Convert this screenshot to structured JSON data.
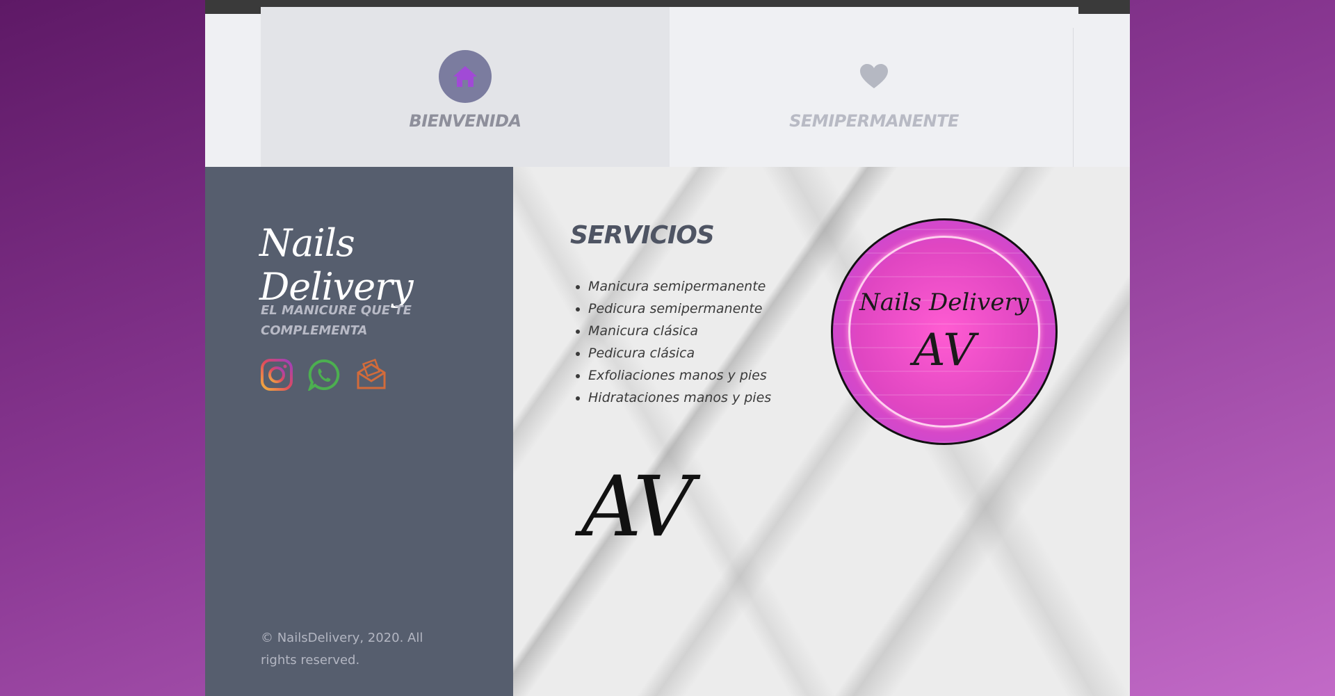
{
  "nav": {
    "tabs": [
      {
        "label": "BIENVENIDA",
        "icon": "home-icon",
        "active": true
      },
      {
        "label": "SEMIPERMANENTE",
        "icon": "heart-icon",
        "active": false
      }
    ]
  },
  "sidebar": {
    "brand": "Nails Delivery",
    "tagline": "EL MANICURE QUE TE COMPLEMENTA",
    "social": [
      "instagram-icon",
      "whatsapp-icon",
      "email-icon"
    ],
    "copyright": "© NailsDelivery, 2020. All rights reserved."
  },
  "main": {
    "title": "SERVICIOS",
    "services": [
      "Manicura semipermanente",
      "Pedicura semipermanente",
      "Manicura clásica",
      "Pedicura clásica",
      "Exfoliaciones manos y pies",
      "Hidrataciones manos y pies"
    ],
    "logo": {
      "line1": "Nails Delivery",
      "line2": "AV"
    },
    "signature": "AV"
  },
  "colors": {
    "accent": "#7b7c9f",
    "sidebar_bg": "#565e6e",
    "logo_pink": "#e046c2"
  }
}
